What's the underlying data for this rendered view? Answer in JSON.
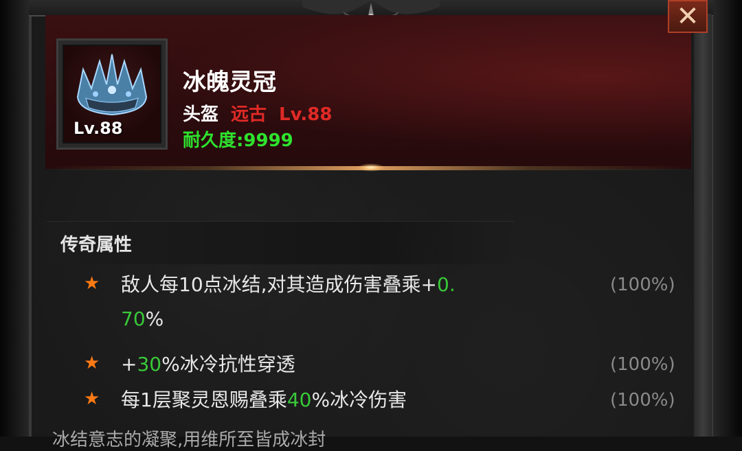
{
  "item": {
    "name": "冰魄灵冠",
    "level_badge": "Lv.88",
    "type": "头盔",
    "rarity": "远古",
    "required_level": "Lv.88",
    "durability_label": "耐久度:",
    "durability_value": "9999"
  },
  "section": {
    "title": "传奇属性"
  },
  "attributes": [
    {
      "pre": "敌人每10点冰结,对其造成伤害叠乘+",
      "highlight": "0.",
      "post": "",
      "line2_highlight": "70",
      "line2_post": "%",
      "percent": "(100%)"
    },
    {
      "pre": "+",
      "highlight": "30",
      "post": "%冰冷抗性穿透",
      "percent": "(100%)"
    },
    {
      "pre": "每1层聚灵恩赐叠乘",
      "highlight": "40",
      "post": "%冰冷伤害",
      "percent": "(100%)"
    }
  ],
  "bottom_text": "冰结意志的凝聚,用维所至皆成冰封",
  "close_label": "✕",
  "colors": {
    "accent_red": "#e02a26",
    "durability_green": "#2ee22e",
    "value_green": "#39c939",
    "star_orange": "#ff7a14"
  },
  "icons": {
    "item": "ice-crown-icon",
    "star": "star-icon",
    "close": "close-icon"
  }
}
